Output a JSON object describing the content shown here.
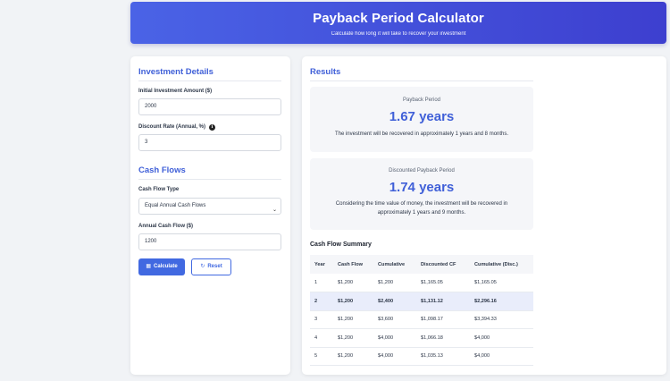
{
  "header": {
    "title": "Payback Period Calculator",
    "subtitle": "Calculate how long it will take to recover your investment"
  },
  "investment": {
    "title": "Investment Details",
    "initial_label": "Initial Investment Amount ($)",
    "initial_value": "2000",
    "discount_label": "Discount Rate (Annual, %)",
    "discount_value": "3"
  },
  "cashflows": {
    "title": "Cash Flows",
    "type_label": "Cash Flow Type",
    "type_value": "Equal Annual Cash Flows",
    "annual_label": "Annual Cash Flow ($)",
    "annual_value": "1200"
  },
  "buttons": {
    "calculate": "Calculate",
    "reset": "Reset"
  },
  "results": {
    "title": "Results",
    "payback": {
      "label": "Payback Period",
      "value": "1.67 years",
      "description": "The investment will be recovered in approximately 1 years and 8 months."
    },
    "discounted": {
      "label": "Discounted Payback Period",
      "value": "1.74 years",
      "description_1": "Considering the time value of money, the investment will be recovered in",
      "description_2": "approximately 1 years and 9 months."
    }
  },
  "summary": {
    "title": "Cash Flow Summary",
    "columns": [
      "Year",
      "Cash Flow",
      "Cumulative",
      "Discounted CF",
      "Cumulative (Disc.)"
    ],
    "rows": [
      [
        "1",
        "$1,200",
        "$1,200",
        "$1,165.05",
        "$1,165.05"
      ],
      [
        "2",
        "$1,200",
        "$2,400",
        "$1,131.12",
        "$2,296.16"
      ],
      [
        "3",
        "$1,200",
        "$3,600",
        "$1,098.17",
        "$3,394.33"
      ],
      [
        "4",
        "$1,200",
        "$4,000",
        "$1,066.18",
        "$4,000"
      ],
      [
        "5",
        "$1,200",
        "$4,000",
        "$1,035.13",
        "$4,000"
      ]
    ],
    "highlight_row": 2
  },
  "colors": {
    "accent": "#4060d8",
    "header_gradient_start": "#4a63e6",
    "header_gradient_end": "#3d3fcf",
    "highlight_row": "#e9edfb"
  },
  "icons": {
    "info": "info-icon",
    "calculator": "calculator-icon",
    "reset": "reset-icon",
    "select": "chevron-down-icon"
  }
}
